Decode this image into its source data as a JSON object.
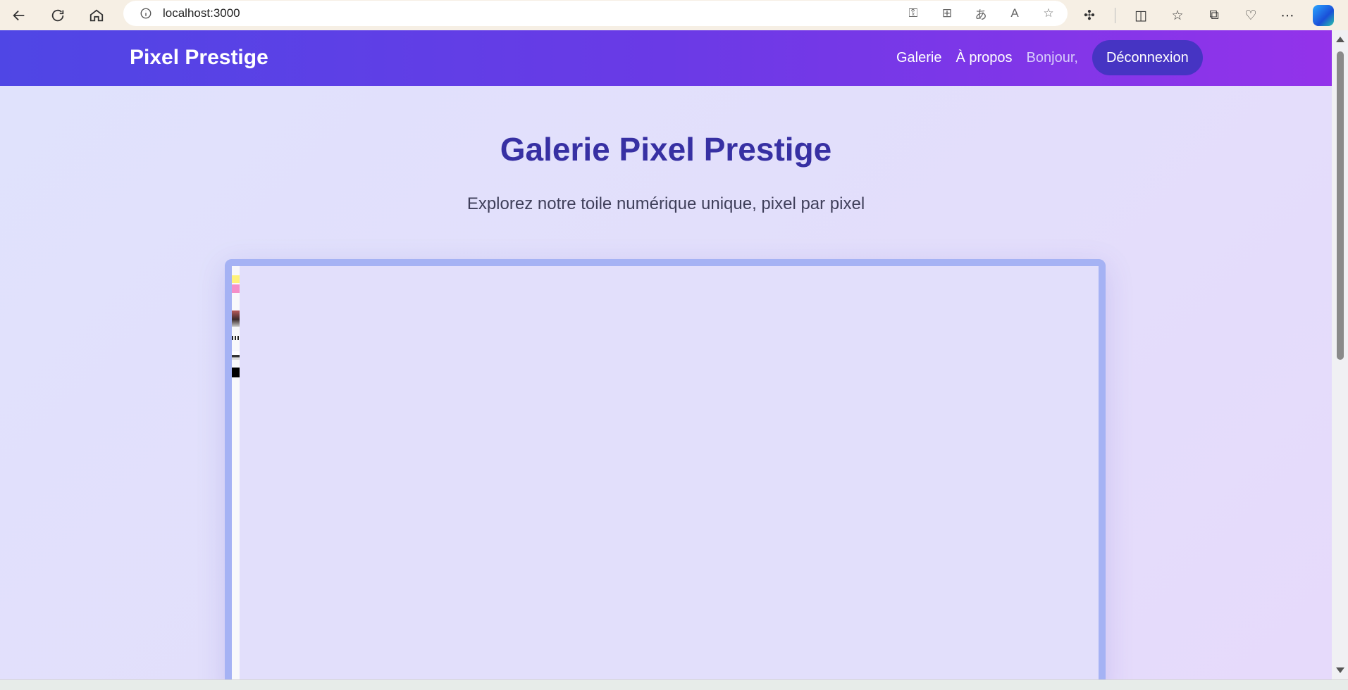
{
  "browser": {
    "url": "localhost:3000"
  },
  "header": {
    "brand": "Pixel Prestige",
    "nav": {
      "gallery": "Galerie",
      "about": "À propos",
      "greeting": "Bonjour,",
      "logout": "Déconnexion"
    }
  },
  "hero": {
    "title": "Galerie Pixel Prestige",
    "subtitle": "Explorez notre toile numérique unique, pixel par pixel"
  },
  "canvas": {
    "pixels": [
      "yellow",
      "pink",
      "image",
      "image",
      "image",
      "black"
    ]
  },
  "colors": {
    "header_start": "#4f46e5",
    "header_end": "#9333ea",
    "title": "#3730a3",
    "logout_bg": "#4634c3",
    "canvas_border": "#a5b2f4"
  }
}
